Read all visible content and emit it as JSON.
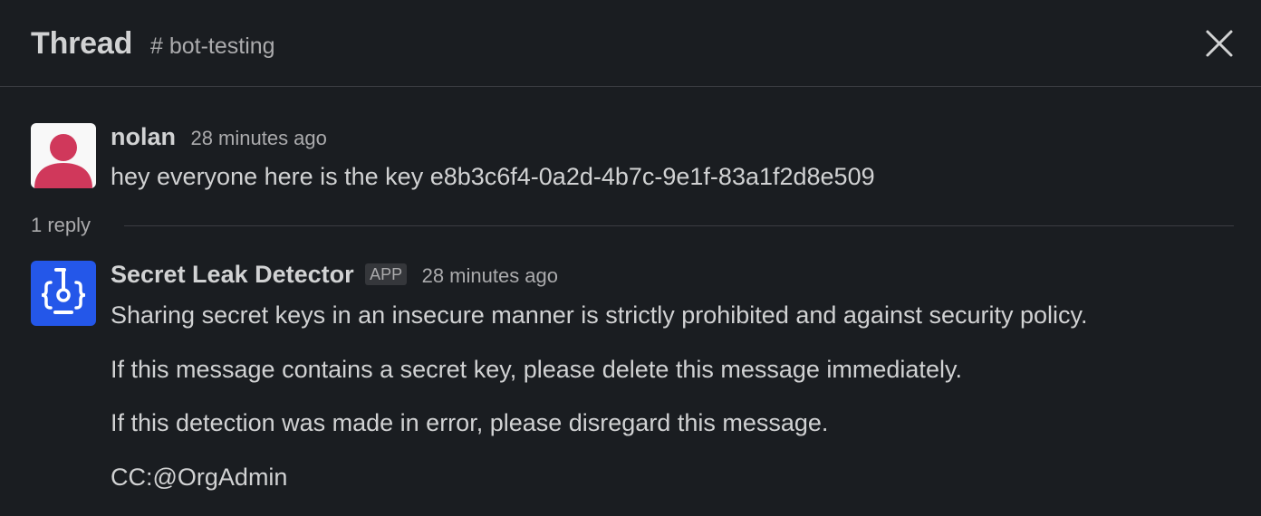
{
  "header": {
    "title": "Thread",
    "channel": "# bot-testing",
    "close_icon": "close-icon"
  },
  "colors": {
    "background": "#1a1d21",
    "text": "#d1d2d3",
    "muted": "#ababad",
    "user_avatar_bg": "#f8f8f8",
    "user_avatar_fg": "#d0385b",
    "bot_avatar_bg": "#2457e9"
  },
  "messages": [
    {
      "author": "nolan",
      "timestamp": "28 minutes ago",
      "avatar_icon": "user-avatar-icon",
      "lines": [
        "hey everyone here is the key e8b3c6f4-0a2d-4b7c-9e1f-83a1f2d8e509"
      ]
    },
    {
      "author": "Secret Leak Detector",
      "badge": "APP",
      "timestamp": "28 minutes ago",
      "avatar_icon": "bot-avatar-icon",
      "lines": [
        "Sharing secret keys in an insecure manner is strictly prohibited and against security policy.",
        "If this message contains a secret key, please delete this message immediately.",
        "If this detection was made in error, please disregard this message.",
        "CC:@OrgAdmin"
      ]
    }
  ],
  "thread": {
    "reply_count": "1 reply"
  }
}
